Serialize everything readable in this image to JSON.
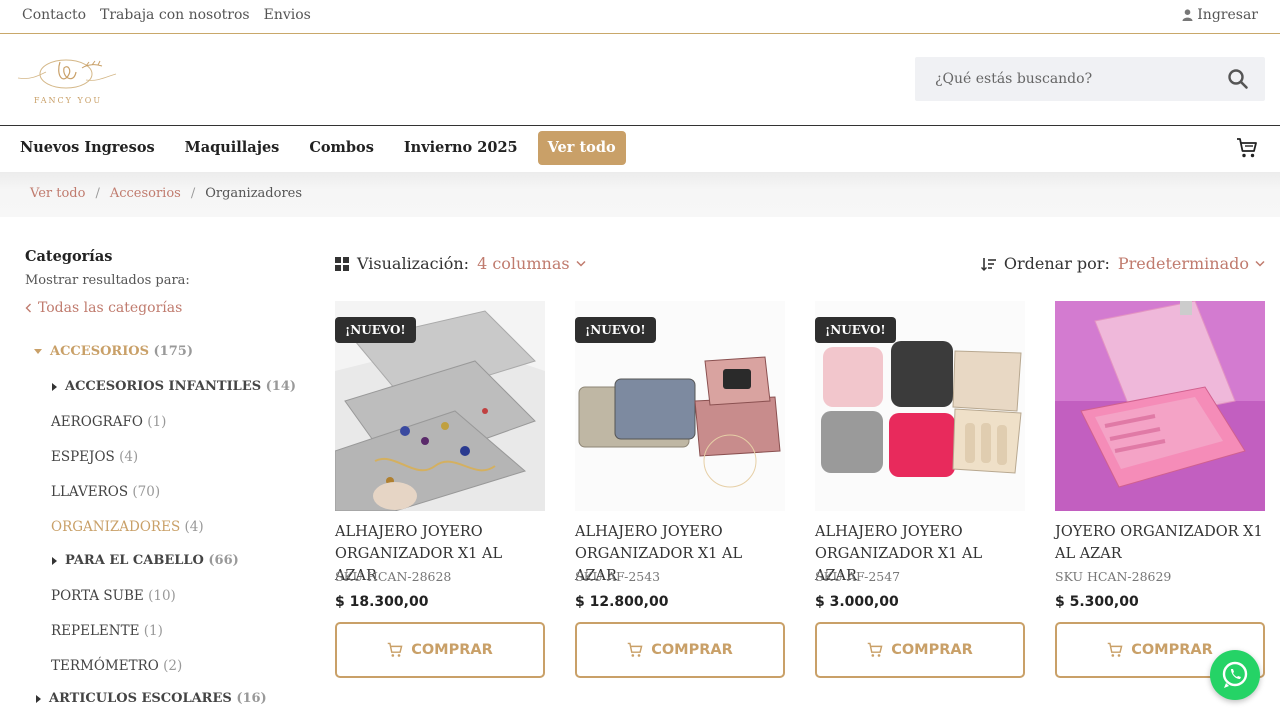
{
  "topbar": {
    "links": [
      "Contacto",
      "Trabaja con nosotros",
      "Envios"
    ],
    "login": "Ingresar"
  },
  "header": {
    "logo_text": "FANCY YOU",
    "search_placeholder": "¿Qué estás buscando?"
  },
  "nav": {
    "items": [
      "Nuevos Ingresos",
      "Maquillajes",
      "Combos",
      "Invierno 2025"
    ],
    "highlight": "Ver todo"
  },
  "breadcrumb": {
    "items": [
      "Ver todo",
      "Accesorios"
    ],
    "current": "Organizadores",
    "separator": "/"
  },
  "sidebar": {
    "title": "Categorías",
    "subtitle": "Mostrar resultados para:",
    "all_link": "Todas las categorías",
    "categories": [
      {
        "label": "ACCESORIOS",
        "count": "(175)"
      },
      {
        "label": "ACCESORIOS INFANTILES",
        "count": "(14)"
      },
      {
        "label": "AEROGRAFO",
        "count": "(1)"
      },
      {
        "label": "ESPEJOS",
        "count": "(4)"
      },
      {
        "label": "LLAVEROS",
        "count": "(70)"
      },
      {
        "label": "ORGANIZADORES",
        "count": "(4)"
      },
      {
        "label": "PARA EL CABELLO",
        "count": "(66)"
      },
      {
        "label": "PORTA SUBE",
        "count": "(10)"
      },
      {
        "label": "REPELENTE",
        "count": "(1)"
      },
      {
        "label": "TERMÓMETRO",
        "count": "(2)"
      },
      {
        "label": "ARTICULOS ESCOLARES",
        "count": "(16)"
      }
    ]
  },
  "toolbar": {
    "view_label": "Visualización:",
    "view_value": "4 columnas",
    "sort_label": "Ordenar por:",
    "sort_value": "Predeterminado"
  },
  "products": [
    {
      "badge": "¡NUEVO!",
      "name": "ALHAJERO JOYERO ORGANIZADOR X1 AL AZAR",
      "sku": "SKU HCAN-28628",
      "price": "$  18.300,00",
      "button": "COMPRAR"
    },
    {
      "badge": "¡NUEVO!",
      "name": "ALHAJERO JOYERO ORGANIZADOR X1 AL AZAR",
      "sku": "SKU AF-2543",
      "price": "$  12.800,00",
      "button": "COMPRAR"
    },
    {
      "badge": "¡NUEVO!",
      "name": "ALHAJERO JOYERO ORGANIZADOR X1 AL AZAR",
      "sku": "SKU AF-2547",
      "price": "$  3.000,00",
      "button": "COMPRAR"
    },
    {
      "badge": "",
      "name": "JOYERO ORGANIZADOR X1 AL AZAR",
      "sku": "SKU HCAN-28629",
      "price": "$  5.300,00",
      "button": "COMPRAR"
    }
  ],
  "colors": {
    "accent_gold": "#c9a068",
    "link_rose": "#c07b6e",
    "whatsapp": "#25d366"
  },
  "icons": [
    "user-icon",
    "search-icon",
    "cart-icon",
    "grid-icon",
    "chevron-down-icon",
    "sort-icon",
    "chevron-left-icon",
    "whatsapp-icon"
  ]
}
